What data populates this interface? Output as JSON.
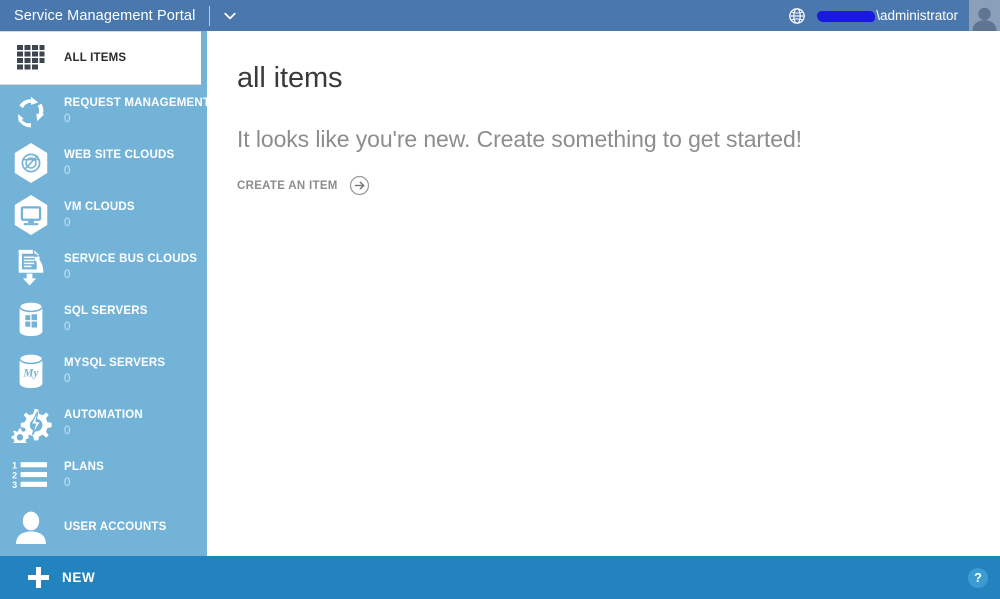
{
  "header": {
    "title": "Service Management Portal",
    "chevron_icon": "chevron-down-icon",
    "globe_icon": "globe-icon",
    "redacted_domain": "",
    "user_name": "\\administrator",
    "avatar_icon": "avatar-icon"
  },
  "sidebar": {
    "items": [
      {
        "label": "ALL ITEMS",
        "count": "",
        "icon": "grid-icon",
        "selected": true
      },
      {
        "label": "REQUEST MANAGEMENT",
        "count": "0",
        "icon": "recycle-arrows-icon",
        "selected": false
      },
      {
        "label": "WEB SITE CLOUDS",
        "count": "0",
        "icon": "hexagon-globe-icon",
        "selected": false
      },
      {
        "label": "VM CLOUDS",
        "count": "0",
        "icon": "hexagon-monitor-icon",
        "selected": false
      },
      {
        "label": "SERVICE BUS CLOUDS",
        "count": "0",
        "icon": "document-arrow-down-icon",
        "selected": false
      },
      {
        "label": "SQL SERVERS",
        "count": "0",
        "icon": "database-windows-icon",
        "selected": false
      },
      {
        "label": "MYSQL SERVERS",
        "count": "0",
        "icon": "database-mysql-icon",
        "selected": false
      },
      {
        "label": "AUTOMATION",
        "count": "0",
        "icon": "gears-bolt-icon",
        "selected": false
      },
      {
        "label": "PLANS",
        "count": "0",
        "icon": "numbered-list-icon",
        "selected": false
      },
      {
        "label": "USER ACCOUNTS",
        "count": "",
        "icon": "person-icon",
        "selected": false
      }
    ]
  },
  "main": {
    "page_title": "all items",
    "empty_message": "It looks like you're new. Create something to get started!",
    "create_label": "CREATE AN ITEM",
    "create_arrow_icon": "arrow-right-circle-icon"
  },
  "commandbar": {
    "new_label": "NEW",
    "plus_icon": "plus-icon",
    "help_label": "?",
    "help_icon": "help-icon"
  },
  "colors": {
    "header_blue": "#4a78ad",
    "sidebar_blue": "#74b3d8",
    "sidebar_edge_blue": "#63a6cf",
    "commandbar_blue": "#2283bf",
    "redaction_blue": "#1a19e0",
    "selected_white": "#ffffff",
    "title_gray": "#3a3a3a",
    "muted_gray": "#8d8d8d"
  }
}
